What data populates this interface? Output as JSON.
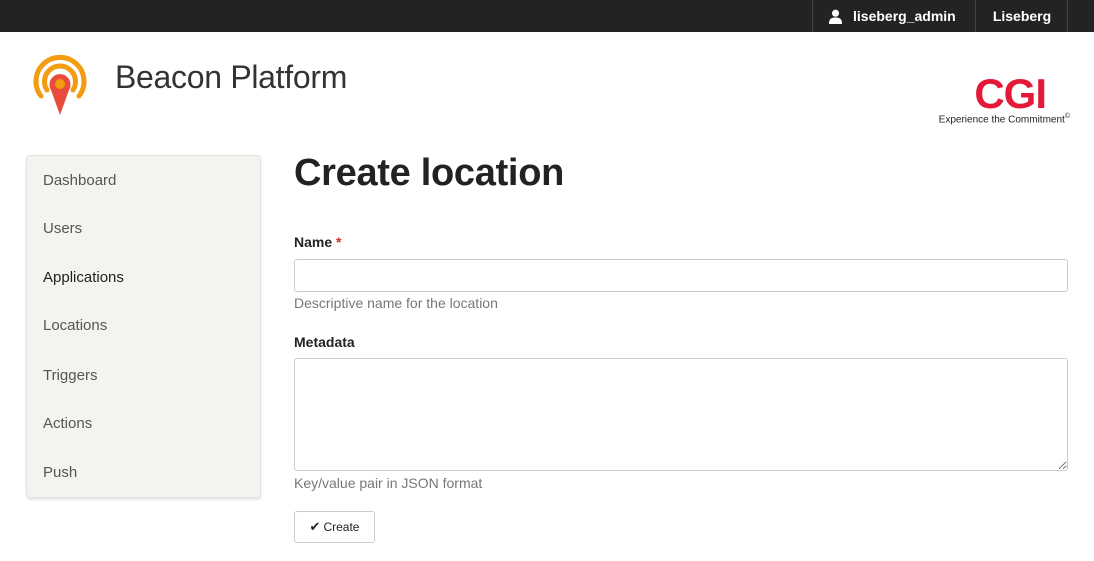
{
  "topbar": {
    "user_icon": "user-icon",
    "username": "liseberg_admin",
    "tenant": "Liseberg"
  },
  "brand": {
    "logo_icon": "beacon-location-icon",
    "name": "Beacon Platform",
    "colors": {
      "logo_orange": "#f39c12",
      "logo_red": "#e74c3c"
    }
  },
  "partner": {
    "logo_text": "CGI",
    "tagline": "Experience the Commitment",
    "mark": "©",
    "color": "#e31937"
  },
  "sidebar": {
    "items": [
      {
        "label": "Dashboard"
      },
      {
        "label": "Users"
      },
      {
        "label": "Applications"
      },
      {
        "label": "Locations"
      },
      {
        "label": "Triggers"
      },
      {
        "label": "Actions"
      },
      {
        "label": "Push"
      }
    ]
  },
  "main": {
    "title": "Create location",
    "fields": {
      "name": {
        "label": "Name",
        "required_mark": "*",
        "value": "",
        "help": "Descriptive name for the location"
      },
      "metadata": {
        "label": "Metadata",
        "value": "",
        "help": "Key/value pair in JSON format"
      }
    },
    "submit": {
      "icon": "checkmark-icon",
      "label": "Create"
    }
  }
}
